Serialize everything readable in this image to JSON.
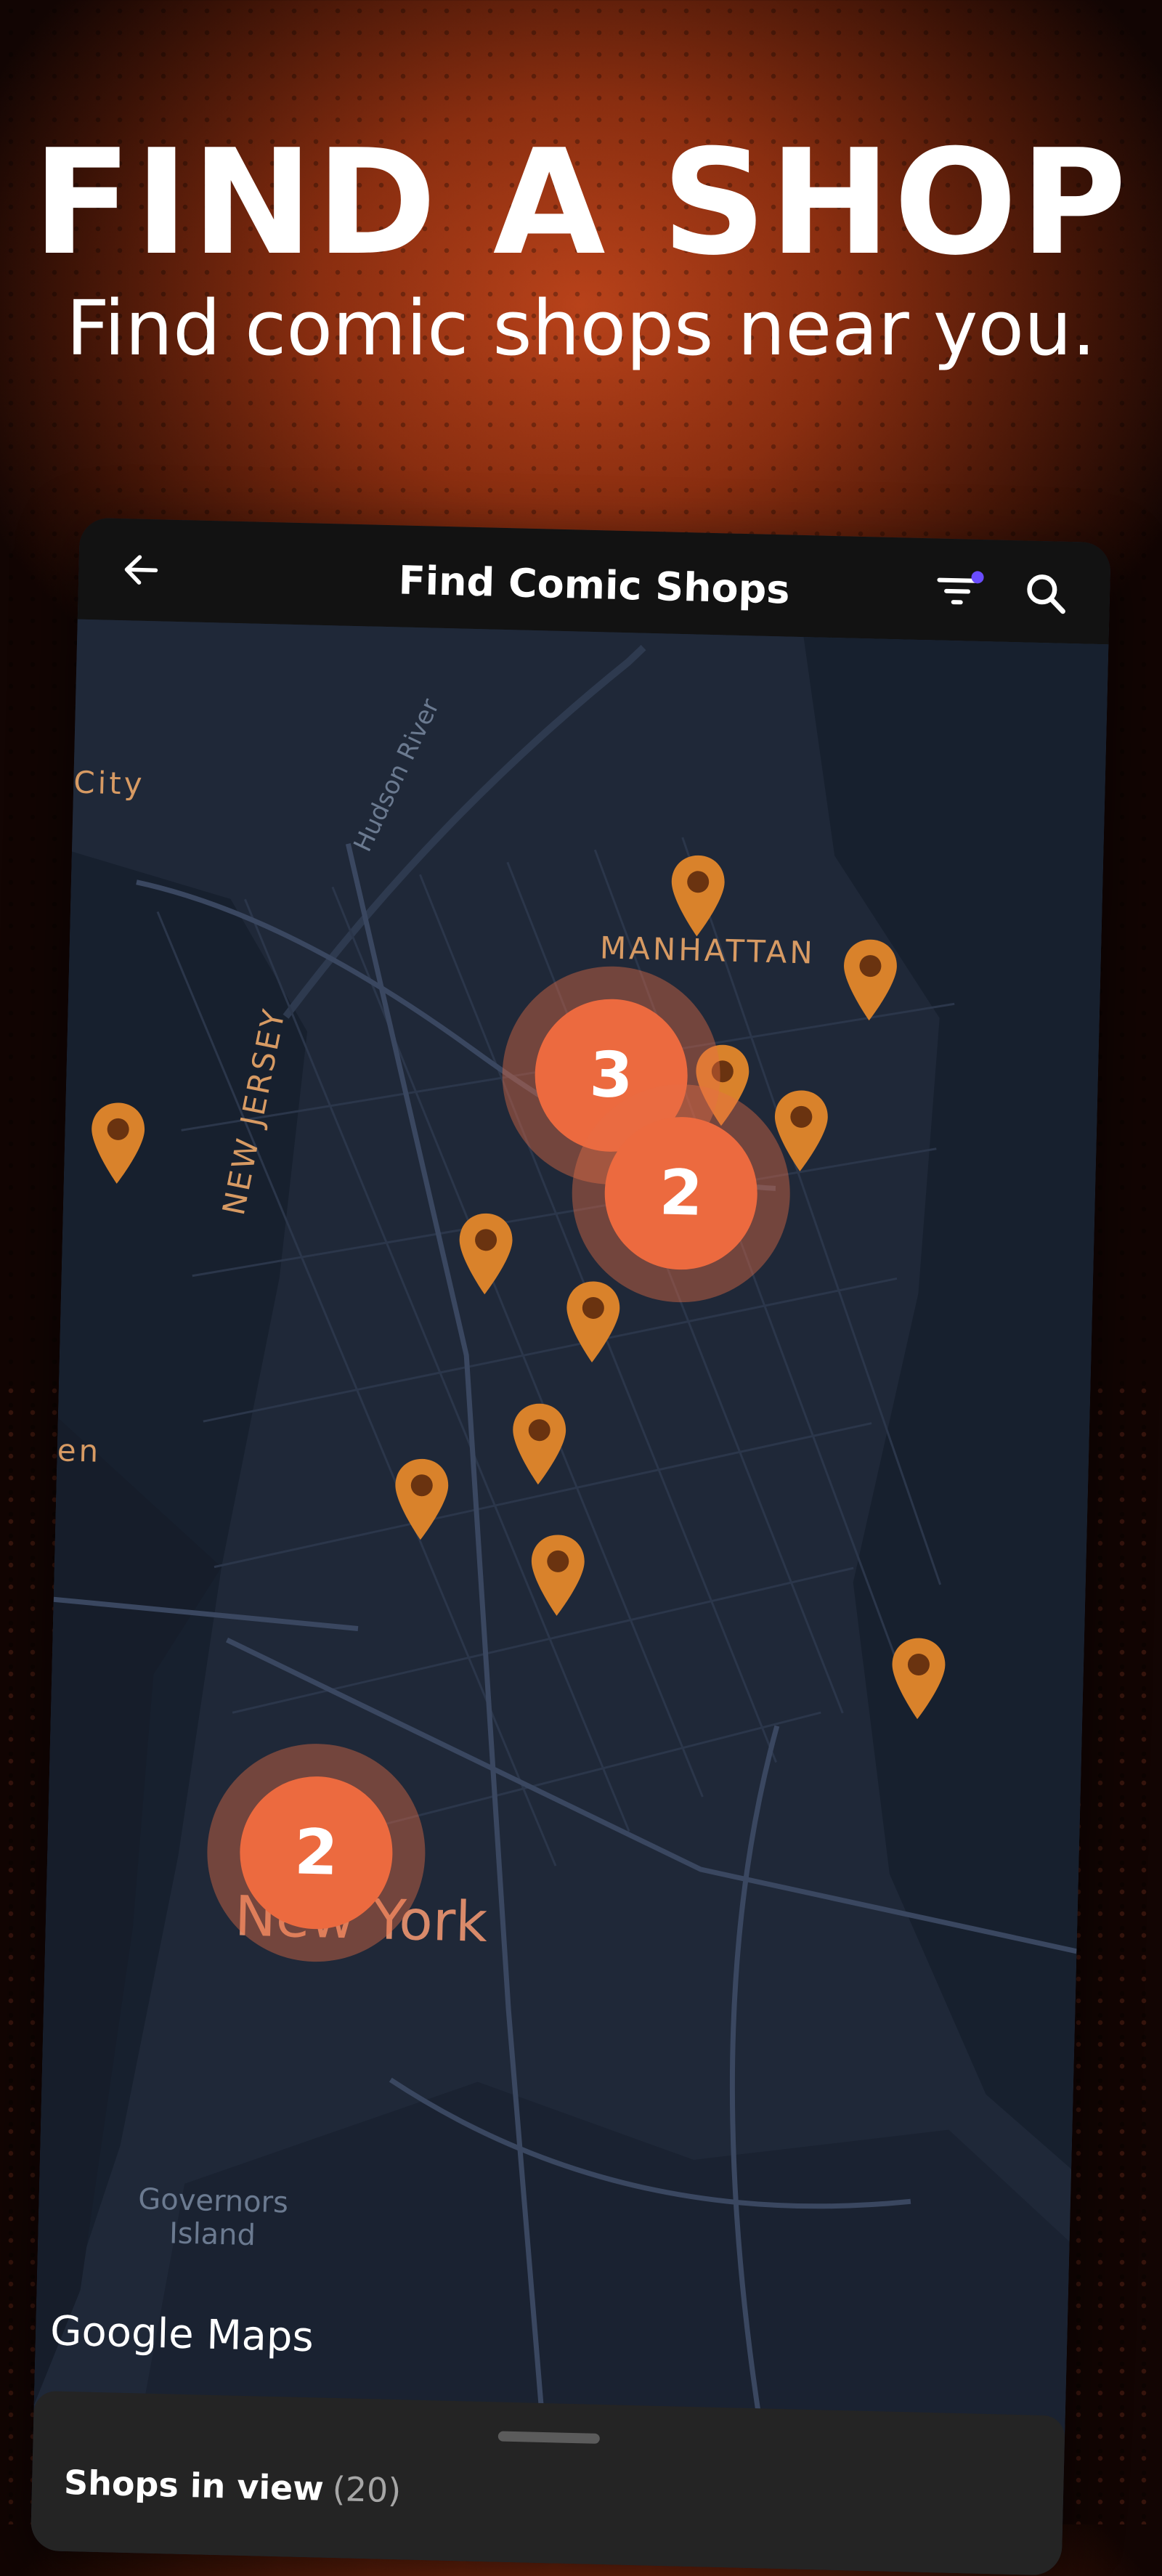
{
  "promo": {
    "headline": "FIND A SHOP",
    "subline": "Find comic shops near you."
  },
  "app": {
    "title": "Find Comic Shops",
    "back_icon": "arrow-left-icon",
    "filter_icon": "filter-icon",
    "search_icon": "search-icon"
  },
  "map": {
    "labels": {
      "manhattan": "MANHATTAN",
      "new_jersey": "NEW JERSEY",
      "new_york": "New York",
      "city": "City",
      "en": "en",
      "hudson_river": "Hudson River",
      "governors_island": "Governors Island"
    },
    "clusters": [
      {
        "count": "3"
      },
      {
        "count": "2"
      },
      {
        "count": "2"
      }
    ],
    "attribution": "Google Maps"
  },
  "sheet": {
    "title": "Shops in view",
    "count": "(20)"
  },
  "colors": {
    "accent": "#ec6a3f",
    "pin": "#d9822b",
    "filter_dot": "#6a4cff",
    "map_bg": "#1f2838"
  }
}
